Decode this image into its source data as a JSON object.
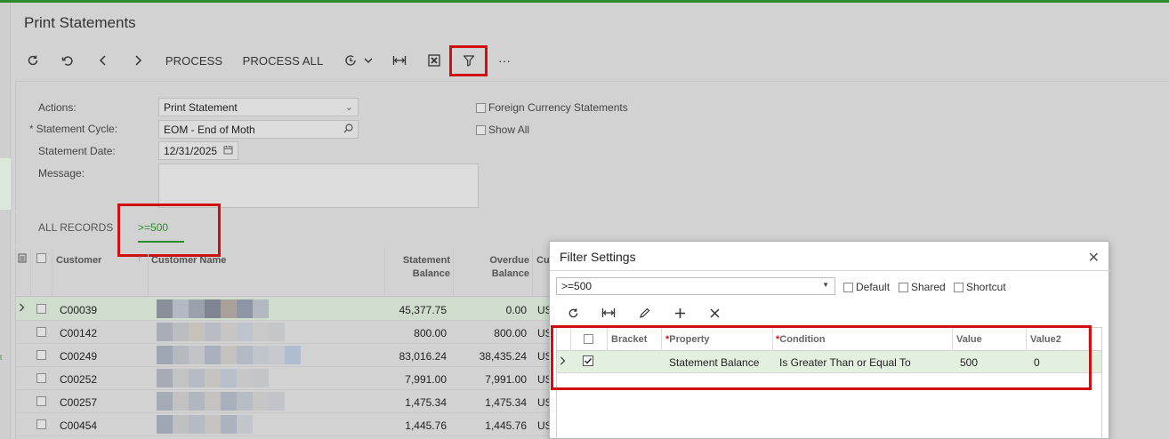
{
  "page_title": "Print Statements",
  "toolbar": {
    "process_label": "PROCESS",
    "process_all_label": "PROCESS ALL",
    "more_label": "···"
  },
  "form": {
    "actions_label": "Actions:",
    "actions_value": "Print Statement",
    "cycle_req": "*",
    "cycle_label": "Statement Cycle:",
    "cycle_value": "EOM - End of Moth",
    "date_label": "Statement Date:",
    "date_value": "12/31/2025",
    "message_label": "Message:",
    "foreign_currency_label": "Foreign Currency Statements",
    "show_all_label": "Show All"
  },
  "tabs": {
    "all_records": "ALL RECORDS",
    "active_filter": ">=500"
  },
  "grid": {
    "headers": {
      "customer": "Customer",
      "customer_name": "Customer Name",
      "statement_balance_1": "Statement",
      "statement_balance_2": "Balance",
      "overdue_balance_1": "Overdue",
      "overdue_balance_2": "Balance",
      "cu": "Cu"
    },
    "rows": [
      {
        "id": "C00039",
        "statement_balance": "45,377.75",
        "overdue_balance": "0.00",
        "cur": "US"
      },
      {
        "id": "C00142",
        "statement_balance": "800.00",
        "overdue_balance": "800.00",
        "cur": "US"
      },
      {
        "id": "C00249",
        "statement_balance": "83,016.24",
        "overdue_balance": "38,435.24",
        "cur": "US"
      },
      {
        "id": "C00252",
        "statement_balance": "7,991.00",
        "overdue_balance": "7,991.00",
        "cur": "US"
      },
      {
        "id": "C00257",
        "statement_balance": "1,475.34",
        "overdue_balance": "1,475.34",
        "cur": "US"
      },
      {
        "id": "C00454",
        "statement_balance": "1,445.76",
        "overdue_balance": "1,445.76",
        "cur": "US"
      }
    ]
  },
  "filter_dialog": {
    "title": "Filter Settings",
    "close_label": "✕",
    "selected_filter": ">=500",
    "default_label": "Default",
    "shared_label": "Shared",
    "shortcut_label": "Shortcut",
    "headers": {
      "bracket": "Bracket",
      "required_mark": "*",
      "property": "Property",
      "condition": "Condition",
      "value": "Value",
      "value2": "Value2"
    },
    "row": {
      "property": "Statement Balance",
      "condition": "Is Greater Than or Equal To",
      "value": "500",
      "value2": "0"
    }
  },
  "colors": {
    "accent_green": "#2e8b2e",
    "highlight_red": "#d01010"
  }
}
